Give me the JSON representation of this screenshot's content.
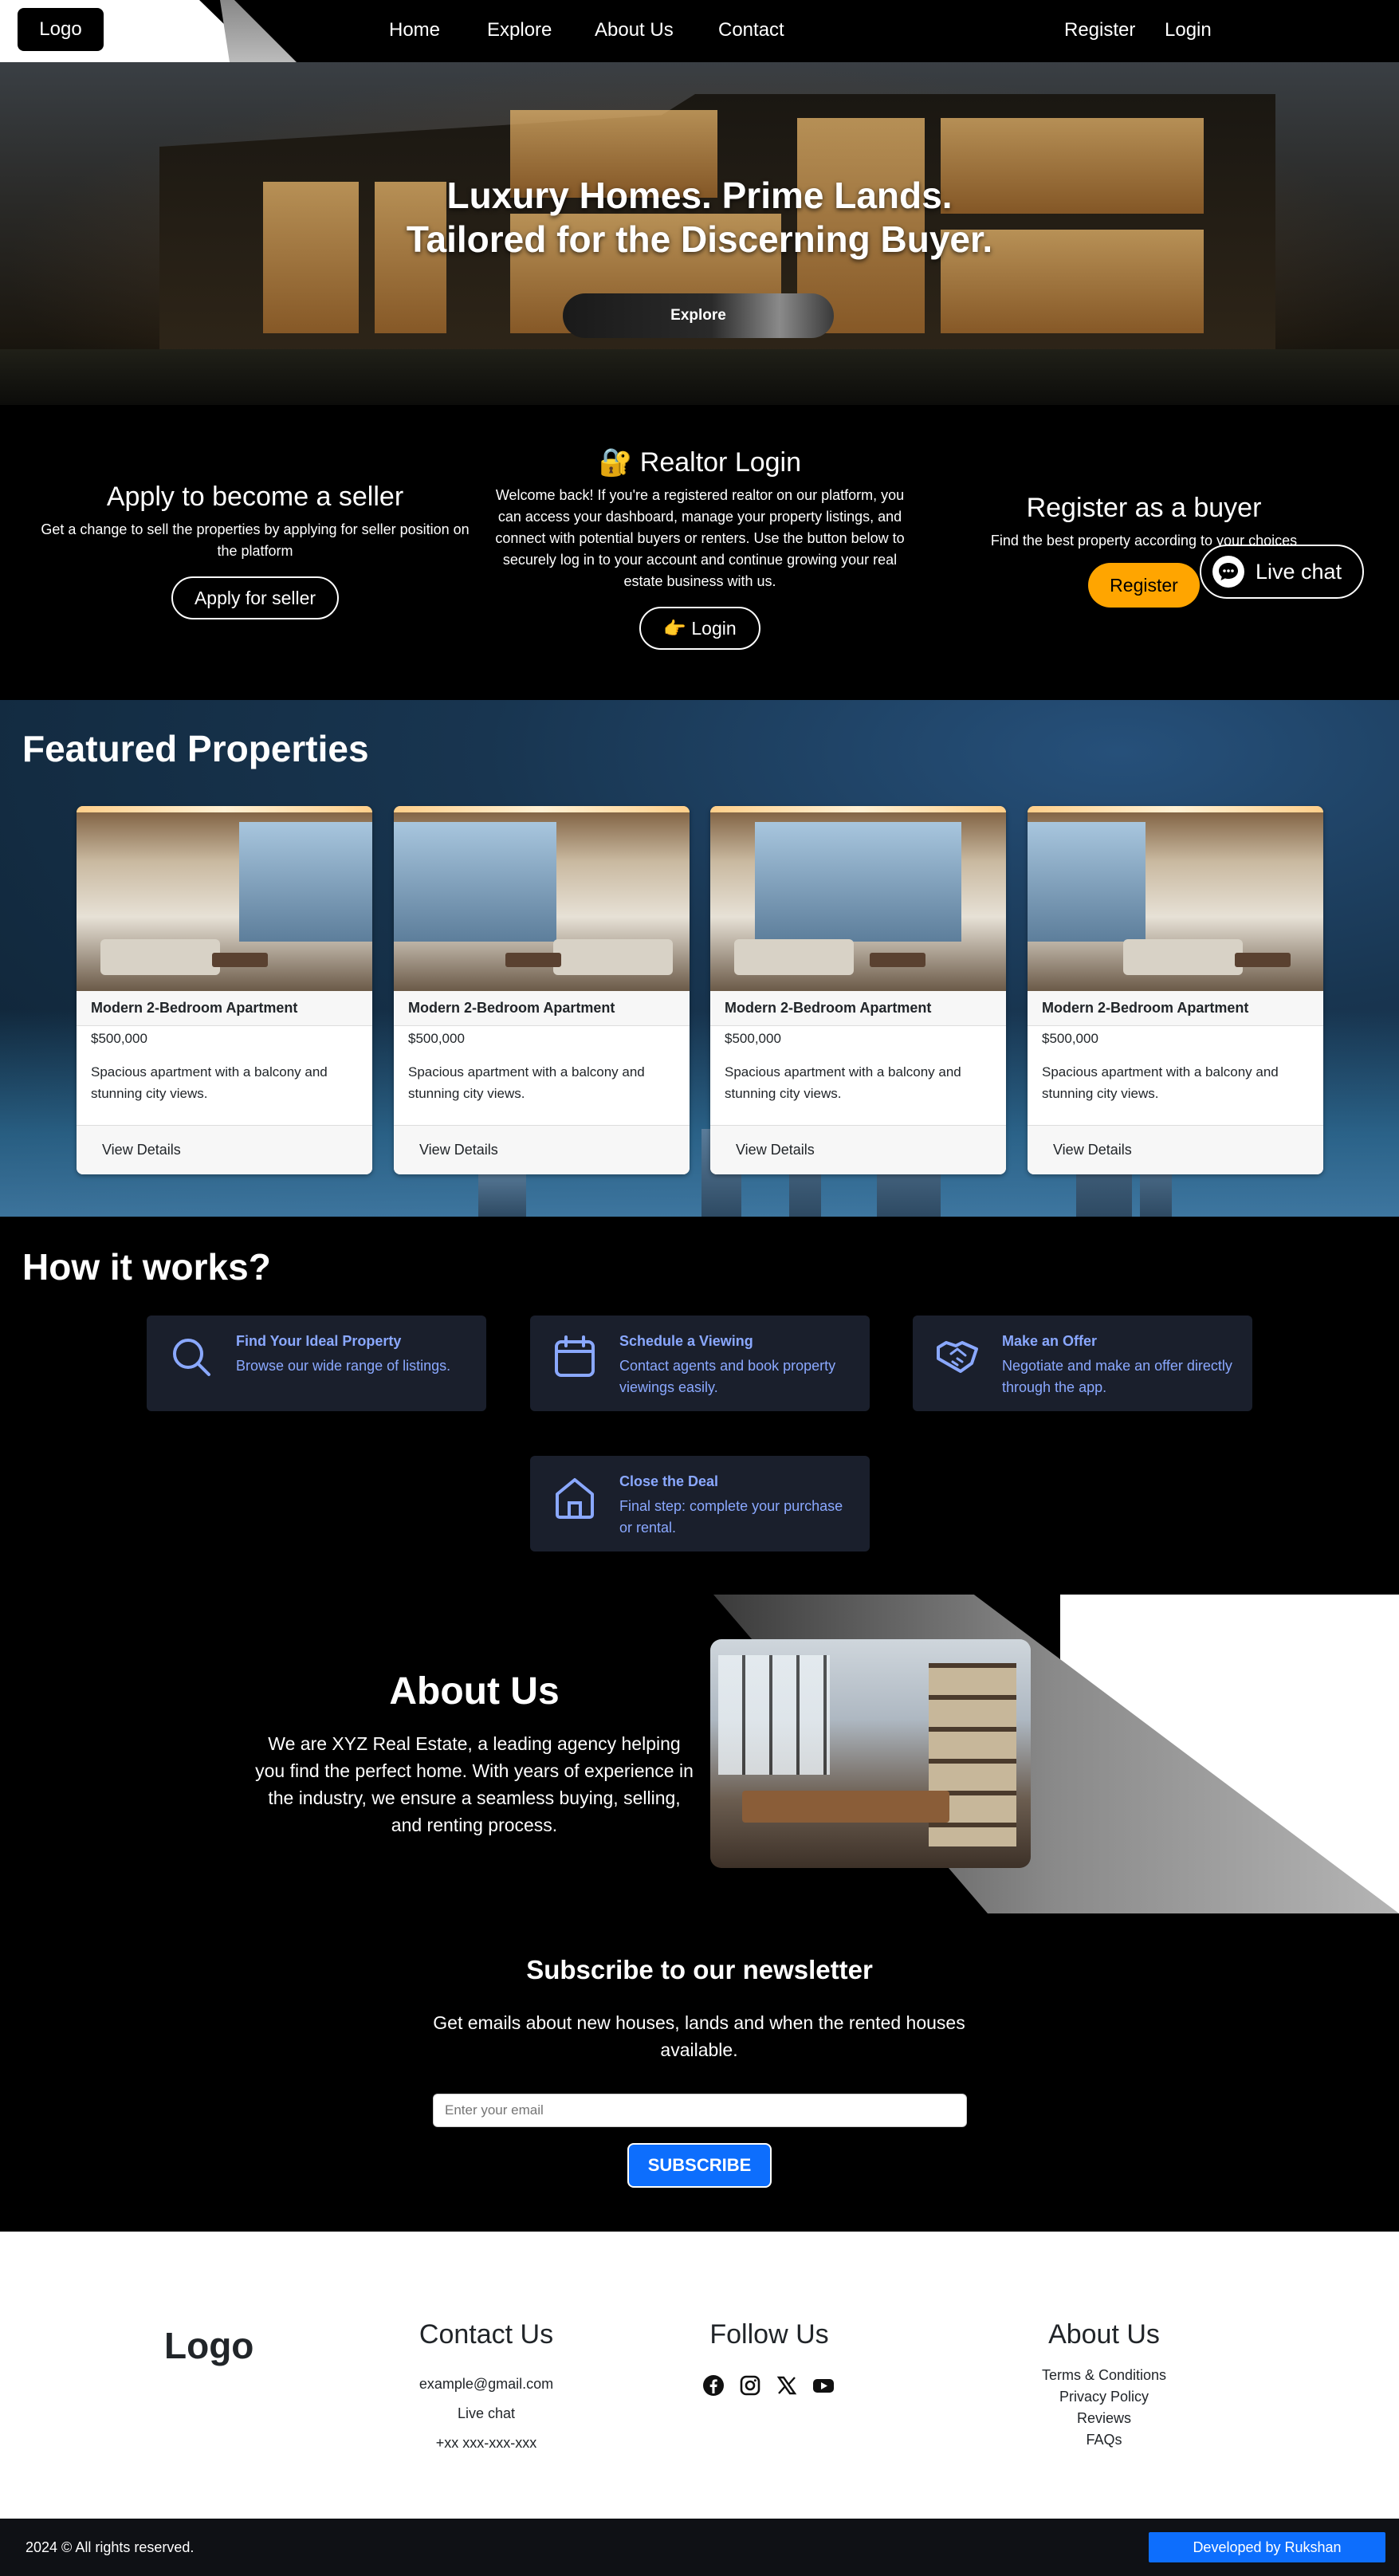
{
  "nav": {
    "logo": "Logo",
    "links": [
      "Home",
      "Explore",
      "About Us",
      "Contact"
    ],
    "register": "Register",
    "login": "Login"
  },
  "hero": {
    "title_line1": "Luxury Homes. Prime Lands.",
    "title_line2": "Tailored for the Discerning Buyer.",
    "button": "Explore"
  },
  "seller": {
    "title": "Apply to become a seller",
    "text": "Get a change to sell the properties by applying for seller position on the platform",
    "button": "Apply for seller"
  },
  "realtor": {
    "title": "🔐 Realtor Login",
    "text": "Welcome back! If you're a registered realtor on our platform, you can access your dashboard, manage your property listings, and connect with potential buyers or renters. Use the button below to securely log in to your account and continue growing your real estate business with us.",
    "button": "👉 Login"
  },
  "buyer": {
    "title": "Register as a buyer",
    "text": "Find the best property according to your choices",
    "button": "Register"
  },
  "live_chat": {
    "label": "Live chat",
    "icon": "chat-icon"
  },
  "featured": {
    "title": "Featured Properties",
    "cards": [
      {
        "title": "Modern 2-Bedroom Apartment",
        "price": "$500,000",
        "desc": "Spacious apartment with a balcony and stunning city views.",
        "button": "View Details"
      },
      {
        "title": "Modern 2-Bedroom Apartment",
        "price": "$500,000",
        "desc": "Spacious apartment with a balcony and stunning city views.",
        "button": "View Details"
      },
      {
        "title": "Modern 2-Bedroom Apartment",
        "price": "$500,000",
        "desc": "Spacious apartment with a balcony and stunning city views.",
        "button": "View Details"
      },
      {
        "title": "Modern 2-Bedroom Apartment",
        "price": "$500,000",
        "desc": "Spacious apartment with a balcony and stunning city views.",
        "button": "View Details"
      }
    ]
  },
  "how": {
    "title": "How it works?",
    "steps": [
      {
        "title": "Find Your Ideal Property",
        "desc": "Browse our wide range of listings.",
        "icon": "search-icon"
      },
      {
        "title": "Schedule a Viewing",
        "desc": "Contact agents and book property viewings easily.",
        "icon": "calendar-icon"
      },
      {
        "title": "Make an Offer",
        "desc": "Negotiate and make an offer directly through the app.",
        "icon": "handshake-icon"
      },
      {
        "title": "Close the Deal",
        "desc": "Final step: complete your purchase or rental.",
        "icon": "house-icon"
      }
    ]
  },
  "about": {
    "title": "About Us",
    "text": "We are XYZ Real Estate, a leading agency helping you find the perfect home. With years of experience in the industry, we ensure a seamless buying, selling, and renting process."
  },
  "newsletter": {
    "title": "Subscribe to our newsletter",
    "text": "Get emails about new houses, lands and when the rented houses available.",
    "placeholder": "Enter your email",
    "button": "SUBSCRIBE"
  },
  "footer": {
    "logo": "Logo",
    "contact": {
      "title": "Contact Us",
      "email": "example@gmail.com",
      "chat": "Live chat",
      "phone": "+xx xxx-xxx-xxx"
    },
    "follow": {
      "title": "Follow Us",
      "icons": [
        "facebook-icon",
        "instagram-icon",
        "x-icon",
        "youtube-icon"
      ]
    },
    "about": {
      "title": "About Us",
      "links": [
        "Terms & Conditions",
        "Privacy Policy",
        "Reviews",
        "FAQs"
      ]
    },
    "copyright": "2024 © All rights reserved.",
    "developer": "Developed by Rukshan"
  },
  "colors": {
    "accent": "#0d6efd",
    "buyer_button": "#ffa500",
    "step_text": "#8aa8ff",
    "step_bg": "#1a1f2c"
  }
}
